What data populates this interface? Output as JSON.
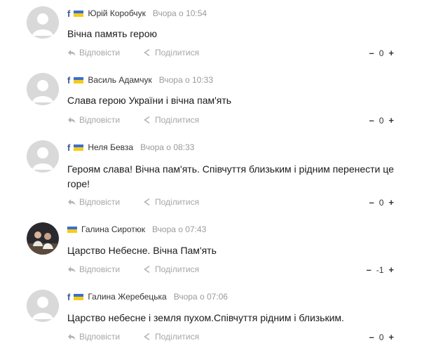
{
  "colors": {
    "flag_blue": "#3a6fd0",
    "flag_yellow": "#f5cc18",
    "facebook": "#3b5998",
    "muted": "#a6a6a6"
  },
  "icons": {
    "reply": "reply-arrow-icon",
    "share": "share-icon",
    "facebook": "facebook-icon",
    "flag": "ukraine-flag-icon"
  },
  "comments": [
    {
      "author": "Юрій Коробчук",
      "time": "Вчора о 10:54",
      "text": "Вічна память герою",
      "reply_label": "Відповісти",
      "share_label": "Поділитися",
      "minus": "–",
      "score": "0",
      "plus": "+",
      "has_facebook": true,
      "avatar": "placeholder"
    },
    {
      "author": "Василь Адамчук",
      "time": "Вчора о 10:33",
      "text": "Слава герою України і вічна пам'ять",
      "reply_label": "Відповісти",
      "share_label": "Поділитися",
      "minus": "–",
      "score": "0",
      "plus": "+",
      "has_facebook": true,
      "avatar": "placeholder"
    },
    {
      "author": "Неля Бевза",
      "time": "Вчора о 08:33",
      "text": "Героям слава! Вічна пам'ять. Співчуття близьким і рідним перенести це горе!",
      "reply_label": "Відповісти",
      "share_label": "Поділитися",
      "minus": "–",
      "score": "0",
      "plus": "+",
      "has_facebook": true,
      "avatar": "placeholder"
    },
    {
      "author": "Галина Сиротюк",
      "time": "Вчора о 07:43",
      "text": "Царство Небесне. Вічна Пам'ять",
      "reply_label": "Відповісти",
      "share_label": "Поділитися",
      "minus": "–",
      "score": "-1",
      "plus": "+",
      "has_facebook": false,
      "avatar": "photo"
    },
    {
      "author": "Галина Жеребецька",
      "time": "Вчора о 07:06",
      "text": "Царство небесне і земля пухом.Співчуття рідним і близьким.",
      "reply_label": "Відповісти",
      "share_label": "Поділитися",
      "minus": "–",
      "score": "0",
      "plus": "+",
      "has_facebook": true,
      "avatar": "placeholder"
    }
  ]
}
